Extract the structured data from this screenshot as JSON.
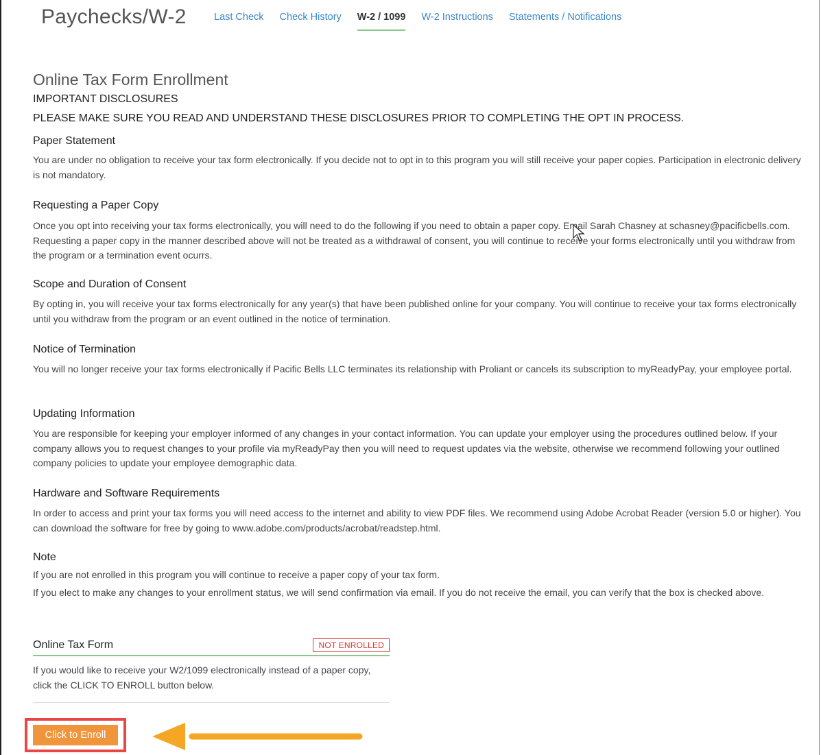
{
  "header": {
    "title": "Paychecks/W-2",
    "tabs": [
      {
        "label": "Last Check",
        "active": false
      },
      {
        "label": "Check History",
        "active": false
      },
      {
        "label": "W-2 / 1099",
        "active": true
      },
      {
        "label": "W-2 Instructions",
        "active": false
      },
      {
        "label": "Statements / Notifications",
        "active": false
      }
    ]
  },
  "main": {
    "title": "Online Tax Form Enrollment",
    "important": "IMPORTANT DISCLOSURES",
    "warning": "PLEASE MAKE SURE YOU READ AND UNDERSTAND THESE DISCLOSURES PRIOR TO COMPLETING THE OPT IN PROCESS.",
    "sections": [
      {
        "heading": "Paper Statement",
        "body": "You are under no obligation to receive your tax form electronically. If you decide not to opt in to this program you will still receive your paper copies. Participation in electronic delivery is not mandatory."
      },
      {
        "heading": "Requesting a Paper Copy",
        "body": "Once you opt into receiving your tax forms electronically, you will need to do the following if you need to obtain a paper copy. Email Sarah Chasney at schasney@pacificbells.com. Requesting a paper copy in the manner described above will not be treated as a withdrawal of consent, you will continue to receive your forms electronically until you withdraw from the program or a termination event ocurrs."
      },
      {
        "heading": "Scope and Duration of Consent",
        "body": "By opting in, you will receive your tax forms electronically for any year(s) that have been published online for your company. You will continue to receive your tax forms electronically until you withdraw from the program or an event outlined in the notice of termination."
      },
      {
        "heading": "Notice of Termination",
        "body": "You will no longer receive your tax forms electronically if Pacific Bells LLC terminates its relationship with Proliant or cancels its subscription to myReadyPay, your employee portal."
      },
      {
        "heading": "Updating Information",
        "body": "You are responsible for keeping your employer informed of any changes in your contact information. You can update your employer using the procedures outlined below. If your company allows you to request changes to your profile via myReadyPay then you will need to request updates via the website, otherwise we recommend following your outlined company policies to update your employee demographic data."
      },
      {
        "heading": "Hardware and Software Requirements",
        "body": "In order to access and print your tax forms you will need access to the internet and ability to view PDF files. We recommend using Adobe Acrobat Reader (version 5.0 or higher). You can download the software for free by going to www.adobe.com/products/acrobat/readstep.html."
      }
    ],
    "note": {
      "heading": "Note",
      "line1": "If you are not enrolled in this program you will continue to receive a paper copy of your tax form.",
      "line2": "If you elect to make any changes to your enrollment status, we will send confirmation via email. If you do not receive the email, you can verify that the box is checked above."
    }
  },
  "enroll": {
    "label": "Online Tax Form",
    "status": "NOT ENROLLED",
    "description": "If you would like to receive your W2/1099 electronically instead of a paper copy, click the CLICK TO ENROLL button below.",
    "button_label": "Click to Enroll"
  },
  "colors": {
    "accent_tab": "#3a86c8",
    "active_underline": "#8bc98b",
    "badge": "#d33333",
    "button": "#f0953b",
    "highlight_box": "#e94646",
    "arrow": "#f5a623"
  }
}
